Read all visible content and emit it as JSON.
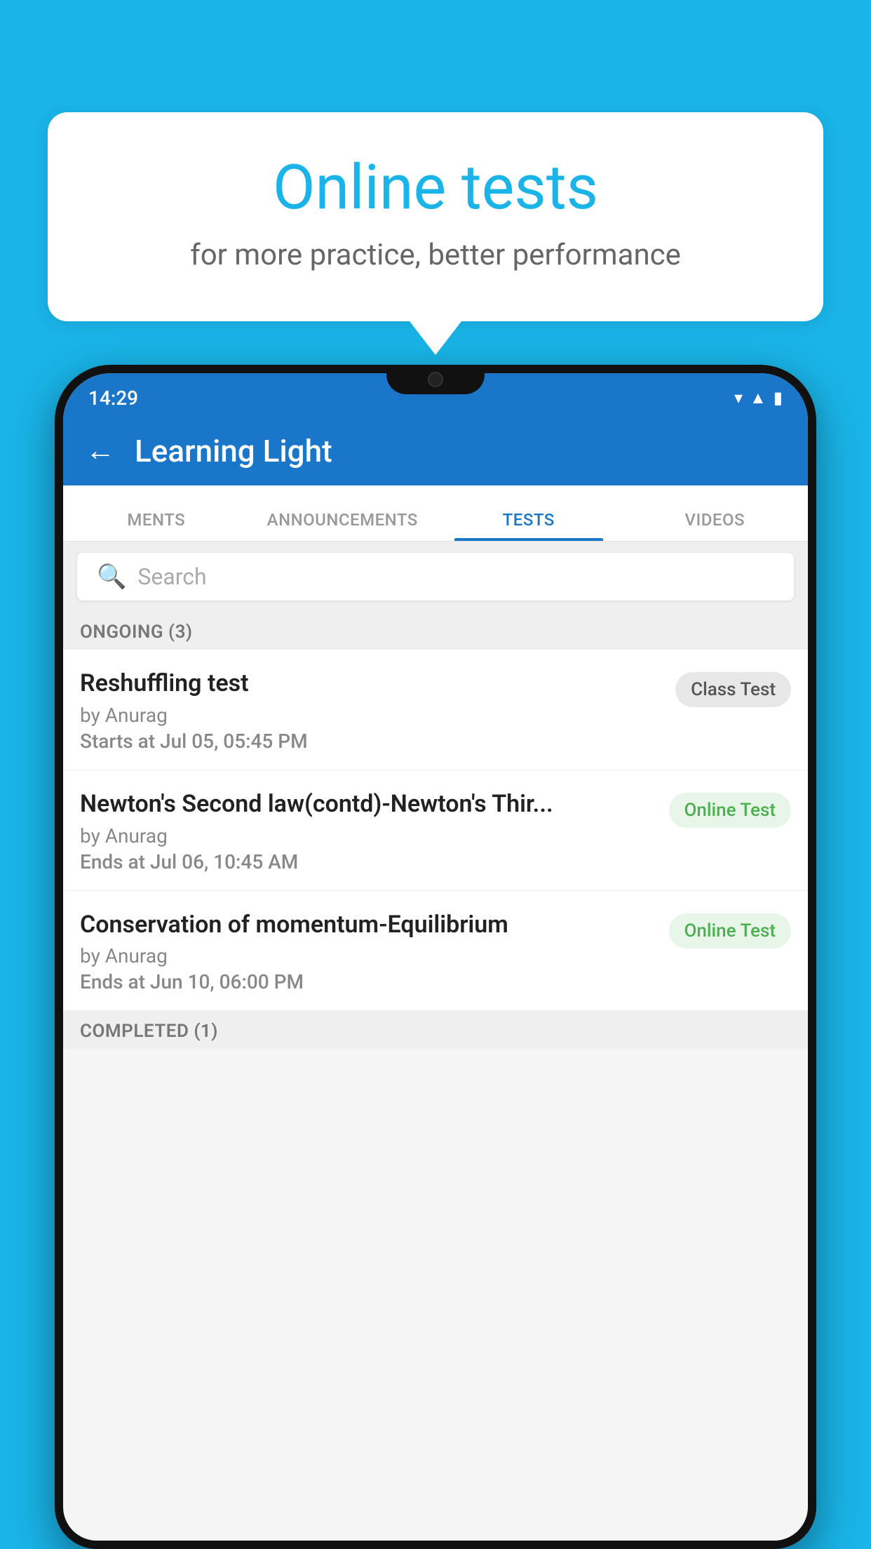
{
  "background_color": "#1ab4e8",
  "bubble": {
    "title": "Online tests",
    "subtitle": "for more practice, better performance"
  },
  "status_bar": {
    "time": "14:29",
    "icons": [
      "wifi",
      "signal",
      "battery"
    ]
  },
  "app_bar": {
    "title": "Learning Light",
    "back_label": "←"
  },
  "tabs": [
    {
      "label": "MENTS",
      "active": false
    },
    {
      "label": "ANNOUNCEMENTS",
      "active": false
    },
    {
      "label": "TESTS",
      "active": true
    },
    {
      "label": "VIDEOS",
      "active": false
    }
  ],
  "search": {
    "placeholder": "Search"
  },
  "ongoing_section": {
    "header": "ONGOING (3)"
  },
  "tests": [
    {
      "name": "Reshuffling test",
      "author": "by Anurag",
      "time_label": "Starts at",
      "time_value": "Jul 05, 05:45 PM",
      "badge": "Class Test",
      "badge_type": "class"
    },
    {
      "name": "Newton's Second law(contd)-Newton's Thir...",
      "author": "by Anurag",
      "time_label": "Ends at",
      "time_value": "Jul 06, 10:45 AM",
      "badge": "Online Test",
      "badge_type": "online"
    },
    {
      "name": "Conservation of momentum-Equilibrium",
      "author": "by Anurag",
      "time_label": "Ends at",
      "time_value": "Jun 10, 06:00 PM",
      "badge": "Online Test",
      "badge_type": "online"
    }
  ],
  "completed_section": {
    "header": "COMPLETED (1)"
  }
}
